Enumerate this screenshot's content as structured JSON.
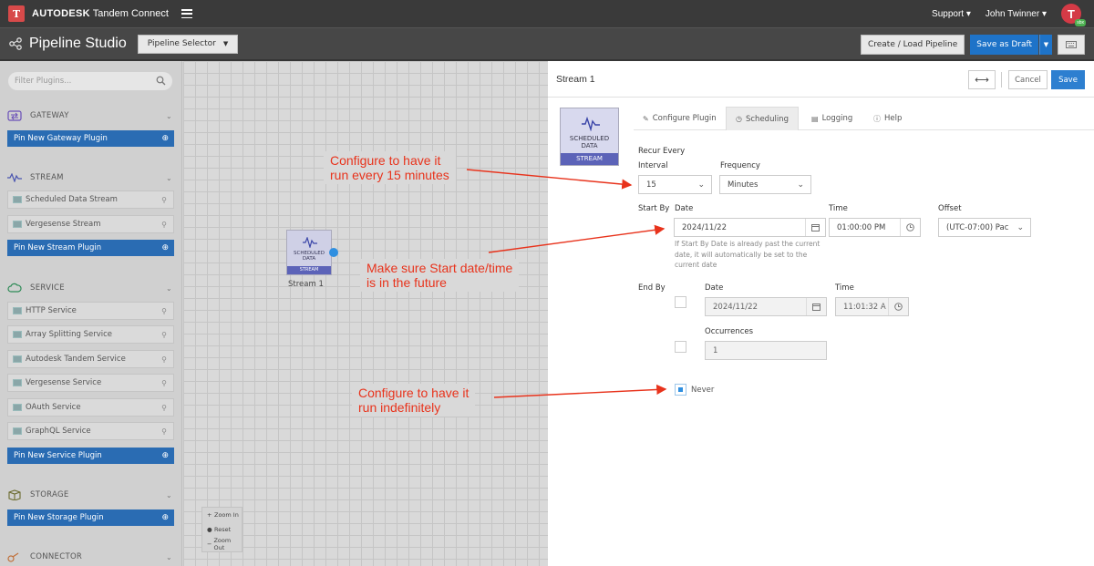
{
  "topbar": {
    "logo_letter": "T",
    "brand_bold": "AUTODESK",
    "brand_rest": "Tandem Connect",
    "support": "Support",
    "user_name": "John Twinner",
    "avatar_letter": "T",
    "avatar_badge": "sbx"
  },
  "subbar": {
    "title": "Pipeline Studio",
    "pipeline_selector": "Pipeline Selector",
    "create_load": "Create / Load Pipeline",
    "save_draft": "Save as Draft"
  },
  "sidebar": {
    "filter_placeholder": "Filter Plugins...",
    "gateway": {
      "title": "GATEWAY",
      "pin": "Pin New Gateway Plugin"
    },
    "stream": {
      "title": "STREAM",
      "items": [
        "Scheduled Data Stream",
        "Vergesense Stream"
      ],
      "pin": "Pin New Stream Plugin"
    },
    "service": {
      "title": "SERVICE",
      "items": [
        "HTTP Service",
        "Array Splitting Service",
        "Autodesk Tandem Service",
        "Vergesense Service",
        "OAuth Service",
        "GraphQL Service"
      ],
      "pin": "Pin New Service Plugin"
    },
    "storage": {
      "title": "STORAGE",
      "pin": "Pin New Storage Plugin"
    },
    "connector": {
      "title": "CONNECTOR"
    }
  },
  "canvas": {
    "node_name_1": "SCHEDULED",
    "node_name_2": "DATA",
    "node_type": "STREAM",
    "node_label": "Stream 1",
    "zoom_in": "Zoom In",
    "reset": "Reset",
    "zoom_out": "Zoom Out"
  },
  "panel": {
    "title": "Stream 1",
    "expand": "⟷",
    "cancel": "Cancel",
    "save": "Save",
    "card_name_1": "SCHEDULED",
    "card_name_2": "DATA",
    "card_type": "STREAM",
    "tabs": {
      "configure": "Configure Plugin",
      "scheduling": "Scheduling",
      "logging": "Logging",
      "help": "Help"
    },
    "recur_every": "Recur Every",
    "interval_label": "Interval",
    "interval_value": "15",
    "frequency_label": "Frequency",
    "frequency_value": "Minutes",
    "start_by": "Start By",
    "date_label": "Date",
    "start_date": "2024/11/22",
    "time_label": "Time",
    "start_time": "01:00:00 PM",
    "offset_label": "Offset",
    "offset_value": "(UTC-07:00) Pac",
    "hint": "If Start By Date is already past the current date, it will automatically be set to the current date",
    "end_by": "End By",
    "end_date_label": "Date",
    "end_date": "2024/11/22",
    "end_time_label": "Time",
    "end_time": "11:01:32 A",
    "occurrences_label": "Occurrences",
    "occurrences_value": "1",
    "never": "Never"
  },
  "annotations": {
    "a1_line1": "Configure to have it",
    "a1_line2": "run every 15 minutes",
    "a2_line1": "Make sure Start date/time",
    "a2_line2": "is in the future",
    "a3_line1": "Configure to have it",
    "a3_line2": "run indefinitely"
  },
  "colors": {
    "accent_blue": "#2d7fd0",
    "stream_purple": "#5c63b8",
    "annotation_red": "#e8331c"
  }
}
